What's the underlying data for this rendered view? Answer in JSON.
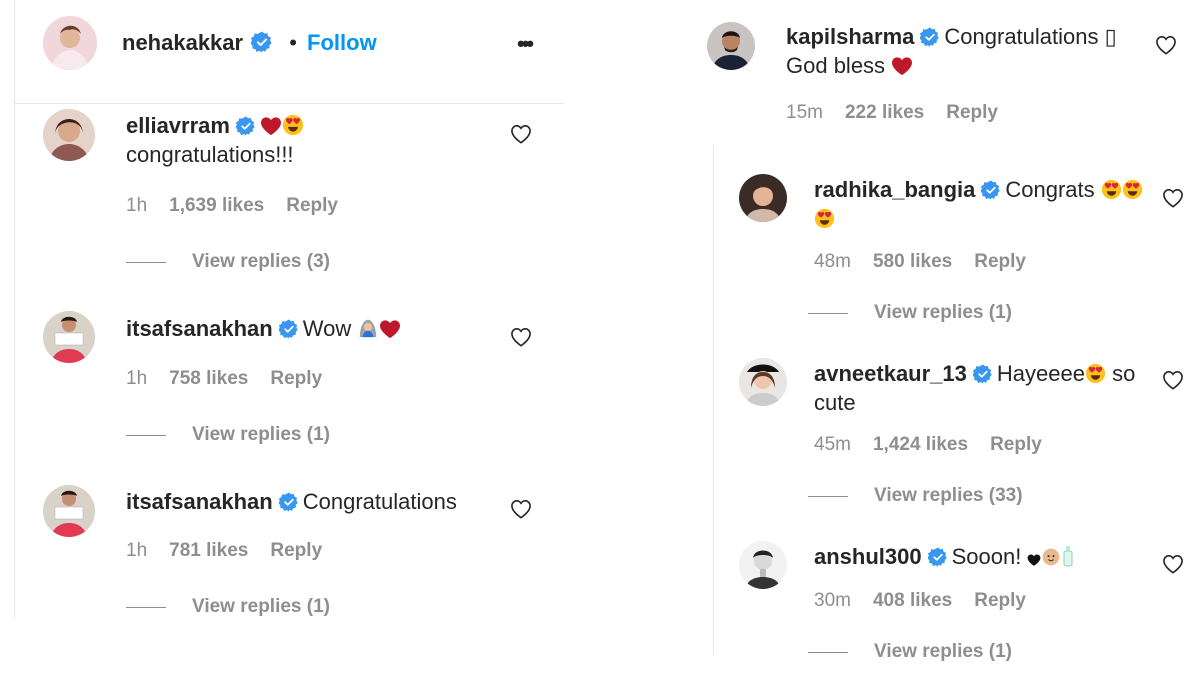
{
  "left": {
    "header": {
      "username": "nehakakkar",
      "separator": "•",
      "follow_label": "Follow",
      "more_label": "•••"
    },
    "comments": [
      {
        "username": "elliavrram",
        "text_line1_suffix": "",
        "text_line2": "congratulations!!!",
        "time": "1h",
        "likes": "1,639 likes",
        "reply": "Reply",
        "view_replies": "View replies (3)"
      },
      {
        "username": "itsafsanakhan",
        "text": "Wow",
        "time": "1h",
        "likes": "758 likes",
        "reply": "Reply",
        "view_replies": "View replies (1)"
      },
      {
        "username": "itsafsanakhan",
        "text": "Congratulations",
        "time": "1h",
        "likes": "781 likes",
        "reply": "Reply",
        "view_replies": "View replies (1)"
      }
    ]
  },
  "right": {
    "comments": [
      {
        "username": "kapilsharma",
        "text_line1": "Congratulations ▯",
        "text_line2": "God bless",
        "time": "15m",
        "likes": "222 likes",
        "reply": "Reply"
      },
      {
        "username": "radhika_bangia",
        "text_line1": "Congrats",
        "time": "48m",
        "likes": "580 likes",
        "reply": "Reply",
        "view_replies": "View replies (1)"
      },
      {
        "username": "avneetkaur_13",
        "text_line1": "Hayeeee",
        "text_line1_tail": "so",
        "text_line2": "cute",
        "time": "45m",
        "likes": "1,424 likes",
        "reply": "Reply",
        "view_replies": "View replies (33)"
      },
      {
        "username": "anshul300",
        "text_line1": "Sooon!",
        "time": "30m",
        "likes": "408 likes",
        "reply": "Reply",
        "view_replies": "View replies (1)"
      }
    ]
  },
  "colors": {
    "link_blue": "#0095f6",
    "verified_blue": "#3897f0",
    "meta_gray": "#8e8e8e",
    "heart_red": "#c0182b"
  },
  "icons": [
    "verified-badge-icon",
    "heart-outline-icon",
    "red-heart-emoji",
    "heart-eyes-emoji",
    "more-options-icon"
  ]
}
